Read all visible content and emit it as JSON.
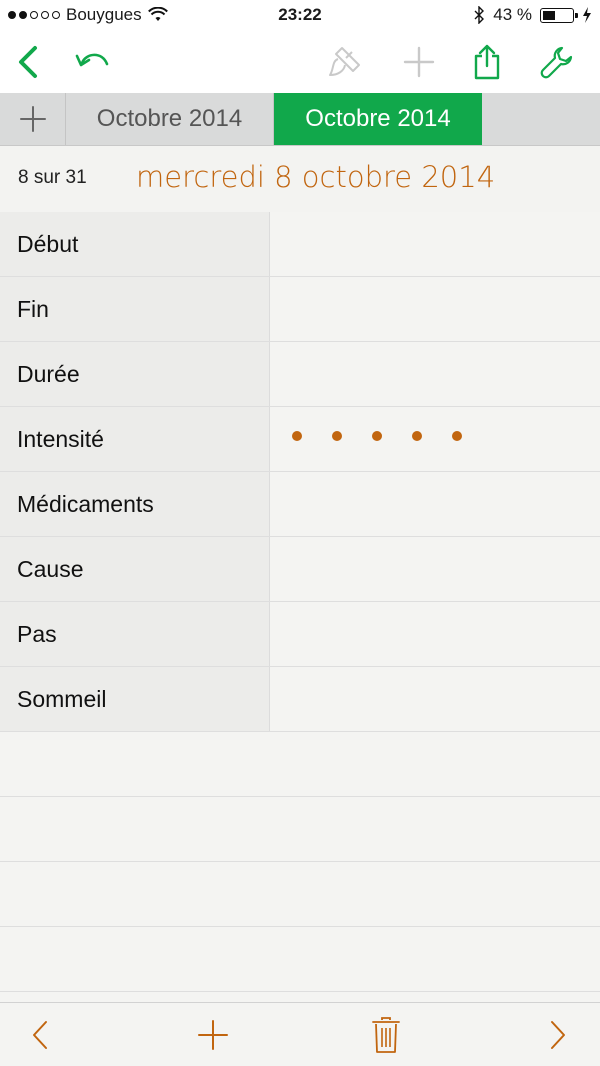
{
  "status_bar": {
    "carrier": "Bouygues",
    "signal_bars": 2,
    "signal_total": 5,
    "time": "23:22",
    "battery_text": "43 %",
    "battery_level": 0.43
  },
  "toolbar": {
    "icons": [
      "back-chevron",
      "undo",
      "paint-brush",
      "add",
      "share",
      "wrench"
    ],
    "accent_color": "#11a84b"
  },
  "tabs": {
    "items": [
      {
        "label": "Octobre 2014",
        "active": false
      },
      {
        "label": "Octobre 2014",
        "active": true
      }
    ],
    "active_color": "#11a84b"
  },
  "header": {
    "record_count": "8 sur 31",
    "date_title": "mercredi 8 octobre 2014",
    "date_color": "#c1650f"
  },
  "fields": [
    {
      "label": "Début",
      "value": ""
    },
    {
      "label": "Fin",
      "value": ""
    },
    {
      "label": "Durée",
      "value": ""
    },
    {
      "label": "Intensité",
      "rating": 0,
      "rating_max": 5
    },
    {
      "label": "Médicaments",
      "value": ""
    },
    {
      "label": "Cause",
      "value": ""
    },
    {
      "label": "Pas",
      "value": ""
    },
    {
      "label": "Sommeil",
      "value": ""
    }
  ],
  "bottom_bar": {
    "icons": [
      "previous-chevron",
      "add",
      "trash",
      "next-chevron"
    ],
    "color": "#c1650f"
  }
}
